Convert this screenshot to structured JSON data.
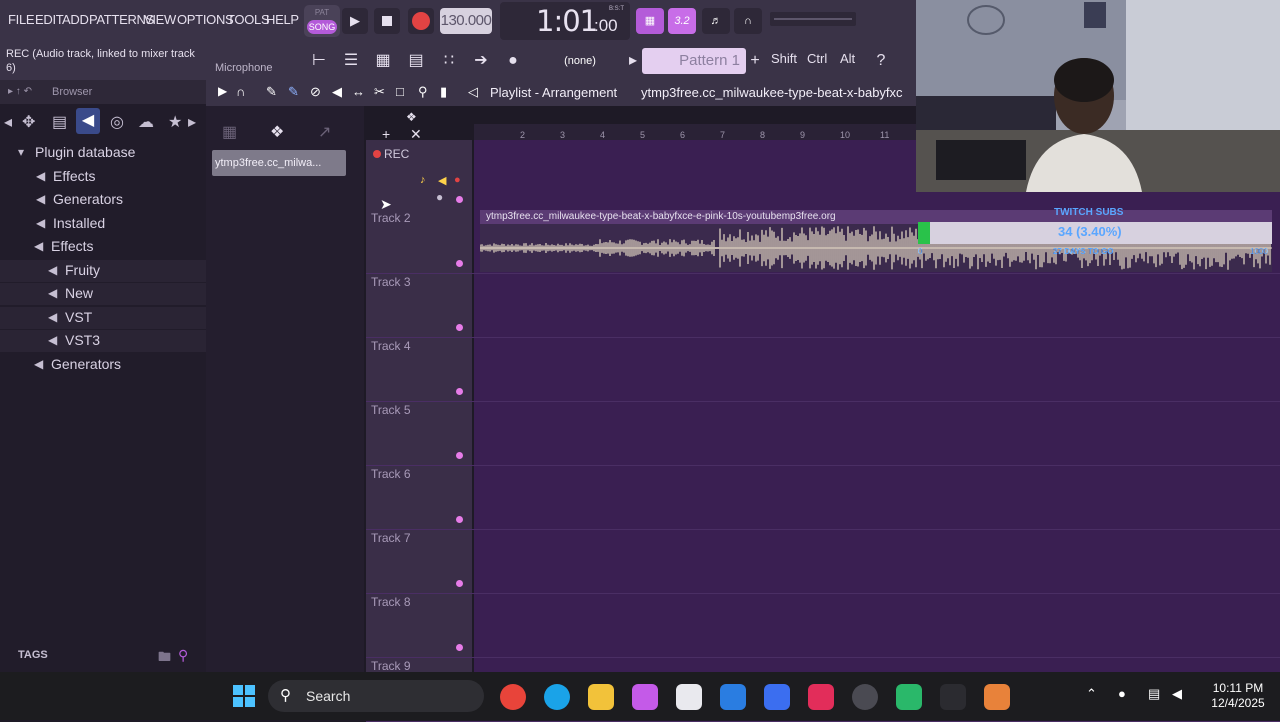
{
  "menu": [
    "FILE",
    "EDIT",
    "ADD",
    "PATTERNS",
    "VIEW",
    "OPTIONS",
    "TOOLS",
    "HELP"
  ],
  "transport": {
    "pat_label": "PAT",
    "song_label": "SONG",
    "tempo": "130.000",
    "time": "1:01",
    "time_small": ":00",
    "time_unit": "B:S:T",
    "snap_glyph": "3.2"
  },
  "hint": {
    "text": "REC (Audio track, linked to mixer track 6)",
    "mic": "Microphone"
  },
  "toolbar2": {
    "none": "(none)",
    "pattern": "Pattern 1",
    "shift": "Shift",
    "ctrl": "Ctrl",
    "alt": "Alt"
  },
  "browser": {
    "title": "Browser",
    "tree": [
      {
        "label": "Plugin database",
        "level": 0,
        "icon": "triangle-icon"
      },
      {
        "label": "Effects",
        "level": 1,
        "icon": "effects-icon"
      },
      {
        "label": "Generators",
        "level": 1,
        "icon": "generators-icon"
      },
      {
        "label": "Installed",
        "level": 1,
        "icon": "plugin-icon"
      },
      {
        "label": "Effects",
        "level": 2,
        "icon": "plugin-icon"
      },
      {
        "label": "Fruity",
        "level": 3,
        "icon": "plugin-icon"
      },
      {
        "label": "New",
        "level": 3,
        "icon": "plugin-icon"
      },
      {
        "label": "VST",
        "level": 3,
        "icon": "plugin-icon"
      },
      {
        "label": "VST3",
        "level": 3,
        "icon": "plugin-icon"
      },
      {
        "label": "Generators",
        "level": 2,
        "icon": "plugin-icon"
      }
    ],
    "tags": "TAGS"
  },
  "channel": {
    "item": "ytmp3free.cc_milwa..."
  },
  "playlist": {
    "title": "Playlist - Arrangement",
    "file": "ytmp3free.cc_milwaukee-type-beat-x-babyfxc",
    "ruler": [
      "2",
      "3",
      "4",
      "5",
      "6",
      "7",
      "8",
      "9",
      "10",
      "11"
    ],
    "rec": "REC",
    "tracks": [
      "Track 2",
      "Track 3",
      "Track 4",
      "Track 5",
      "Track 6",
      "Track 7",
      "Track 8",
      "Track 9"
    ],
    "clip": "ytmp3free.cc_milwaukee-type-beat-x-babyfxce-e-pink-10s-youtubemp3free.org"
  },
  "twitch": {
    "title": "TWITCH SUBS",
    "value": "34 (3.40%)",
    "sub": "27 DAYS TO GO",
    "min": "0",
    "max": "1000",
    "progress": 0.034
  },
  "taskbar": {
    "search": "Search",
    "time": "10:11 PM",
    "date": "12/4/2025"
  },
  "colors": {
    "accent": "#b45bd9",
    "grid": "#3a1f52",
    "record": "#e24343",
    "progress": "#29c24a"
  }
}
